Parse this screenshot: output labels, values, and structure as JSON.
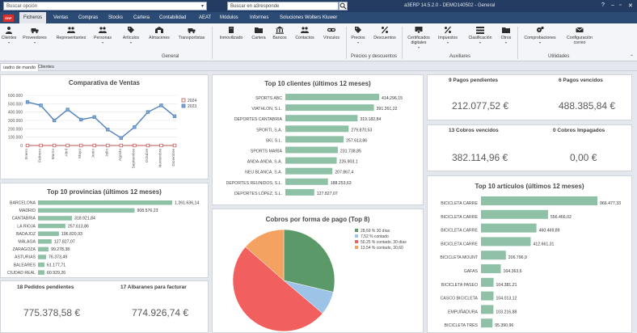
{
  "titlebar": {
    "search_option": "Buscar opción",
    "search_placeholder": "Buscar en a3responde",
    "app_title": "a3ERP 14.5.2.0 - DEMO140502 - General"
  },
  "menu": {
    "logo": "ERP",
    "items": [
      "Ficheros",
      "Ventas",
      "Compras",
      "Stocks",
      "Cartera",
      "Contabilidad",
      "AEAT",
      "Módulos",
      "Informes",
      "Soluciones Wolters Kluwer"
    ]
  },
  "ribbon": {
    "buttons": [
      "Clientes",
      "Proveedores",
      "Representantes",
      "Personas",
      "Artículos",
      "Almacenes",
      "Transportistas",
      "Inmovilizado",
      "Cartera",
      "Bancos",
      "Contactos",
      "Vínculos",
      "Precios",
      "Descuentos",
      "Certificados digitales",
      "Impuestos",
      "Clasificación",
      "Otros",
      "Comprobaciones",
      "Configuración correo"
    ],
    "groups": [
      "General",
      "Precios y descuentos",
      "Auxiliares",
      "Utilidades"
    ]
  },
  "doc_tabs": [
    "uadro de mando",
    "Clientes"
  ],
  "ventas_chart": {
    "title": "Comparativa de Ventas"
  },
  "clientes_chart": {
    "title": "Top 10 clientes (últimos 12 meses)"
  },
  "provincias_chart": {
    "title": "Top 10 provincias (últimos 12 meses)"
  },
  "cobros_chart": {
    "title": "Cobros por forma de pago (Top 8)"
  },
  "articulos_chart": {
    "title": "Top 10 artículos (últimos 12 meses)"
  },
  "kpis": {
    "pagos_pendientes_label": "9 Pagos pendientes",
    "pagos_pendientes_value": "212.077,52 €",
    "pagos_vencidos_label": "6 Pagos vencidos",
    "pagos_vencidos_value": "488.385,84 €",
    "cobros_vencidos_label": "13 Cobros vencidos",
    "cobros_vencidos_value": "382.114,96 €",
    "cobros_impagados_label": "0 Cobros Impagados",
    "cobros_impagados_value": "0,00 €",
    "pedidos_label": "18 Pedidos pendientes",
    "pedidos_value": "775.378,58 €",
    "albaranes_label": "17 Albaranes para facturar",
    "albaranes_value": "774.926,74 €"
  },
  "colors": {
    "bar": "#8fc1a7",
    "line2024": "#c0504d",
    "line2023": "#4f81bd",
    "titlebar": "#243c61",
    "menubar": "#2b4a74"
  },
  "chart_data": [
    {
      "id": "ventas",
      "type": "line",
      "title": "Comparativa de Ventas",
      "categories": [
        "Enero",
        "Febrero",
        "Marzo",
        "Abril",
        "Mayo",
        "Junio",
        "Julio",
        "Agosto",
        "Septiembre",
        "Octubre",
        "Noviembre",
        "Diciembre"
      ],
      "ytick_labels": [
        "600.000",
        "500.000",
        "400.000",
        "300.000",
        "200.000",
        "100.000",
        "0"
      ],
      "ylim": [
        0,
        600000
      ],
      "legend_position": "top-right",
      "series": [
        {
          "name": "2024",
          "values": [
            0,
            0,
            0,
            0,
            0,
            0,
            0,
            0,
            0,
            0,
            0,
            0
          ]
        },
        {
          "name": "2023",
          "values": [
            520000,
            480000,
            300000,
            430000,
            310000,
            340000,
            190000,
            90000,
            220000,
            400000,
            480000,
            350000
          ]
        }
      ]
    },
    {
      "id": "clientes",
      "type": "bar",
      "title": "Top 10 clientes (últimos 12 meses)",
      "orientation": "horizontal",
      "categories": [
        "SPORTS ABC",
        "VIATHLON, S.L.",
        "DEPORTES CANTABRIA",
        "SPORTI, S.A.",
        "SKI, S.L.",
        "SPORTS MARÍA",
        "ANDA-ANDA, S.A.",
        "NEU BLANCA, S.A.",
        "DEPORTES REUNIDOS, S.L.",
        "DEPORTES LÓPEZ, S.L."
      ],
      "values": [
        414296.15,
        391261.22,
        319182.84,
        279870.53,
        257613.86,
        231738.85,
        226903.1,
        207867.4,
        188253.63,
        127827.07
      ],
      "labels": [
        "414.296,15",
        "391.261,22",
        "319.182,84",
        "279.870,53",
        "257.613,86",
        "231.738,85",
        "226.903,1",
        "207.867,4",
        "188.253,63",
        "127.827,07"
      ],
      "xlim": [
        0,
        414296.15
      ]
    },
    {
      "id": "provincias",
      "type": "bar",
      "title": "Top 10 provincias (últimos 12 meses)",
      "orientation": "horizontal",
      "categories": [
        "BARCELONA",
        "MADRID",
        "CANTABRIA",
        "LA RIOJA",
        "BADAJOZ",
        "MÁLAGA",
        "ZARAGOZA",
        "ASTURIAS",
        "BALEARES",
        "CIUDAD REAL"
      ],
      "values": [
        1261636.14,
        908576.23,
        318921.84,
        257613.86,
        196820.93,
        127827.07,
        99278.38,
        76373.49,
        61177.71,
        60929.26
      ],
      "labels": [
        "1.261.636,14",
        "908.576,23",
        "318.921,84",
        "257.613,86",
        "196.820,93",
        "127.827,07",
        "99.278,38",
        "76.373,49",
        "61.177,71",
        "60.929,26"
      ],
      "xlim": [
        0,
        1261636.14
      ]
    },
    {
      "id": "cobros",
      "type": "pie",
      "title": "Cobros por forma de pago (Top 8)",
      "legend_position": "right",
      "labels": [
        "28,69 % 30 días",
        "7,52 % contado",
        "50,25 % contado, 30 días",
        "13,54 % contado, 30,60"
      ],
      "values": [
        28.69,
        7.52,
        50.25,
        13.54
      ],
      "colors": [
        "#5b9a68",
        "#9dc3e6",
        "#f25f5f",
        "#f4a261"
      ]
    },
    {
      "id": "articulos",
      "type": "bar",
      "title": "Top 10 artículos (últimos 12 meses)",
      "orientation": "horizontal",
      "categories": [
        "BICICLETA CARRE",
        "BICICLETA CARRE",
        "BICICLETA CARRE",
        "BICICLETA CARRE",
        "BICICLETA MOUNT",
        "GAFAS",
        "BICICLETA PASEO",
        "CASCO BICICLETA",
        "EMPUÑADURA",
        "BICICLETA TRES"
      ],
      "values": [
        966477.33,
        556466.02,
        460469.89,
        412661.31,
        206796.9,
        164363.6,
        104381.21,
        104013.12,
        103216.88,
        95390.96
      ],
      "labels": [
        "966.477,33",
        "556.466,02",
        "460.469,89",
        "412.661,31",
        "206.796,9",
        "164.363,6",
        "104.381,21",
        "104.013,12",
        "103.216,88",
        "95.390,96"
      ],
      "xlim": [
        0,
        966477.33
      ]
    }
  ]
}
